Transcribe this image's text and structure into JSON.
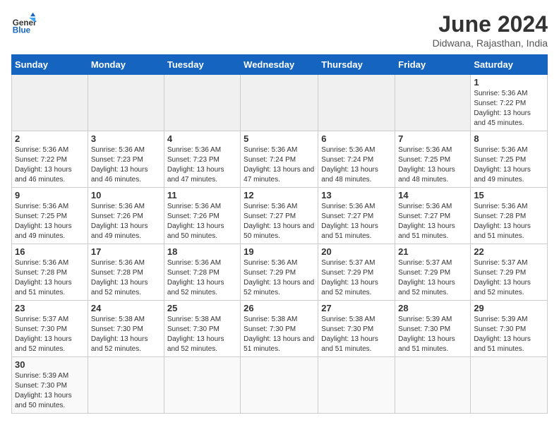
{
  "logo": {
    "text_general": "General",
    "text_blue": "Blue"
  },
  "header": {
    "month_year": "June 2024",
    "location": "Didwana, Rajasthan, India"
  },
  "weekdays": [
    "Sunday",
    "Monday",
    "Tuesday",
    "Wednesday",
    "Thursday",
    "Friday",
    "Saturday"
  ],
  "weeks": [
    [
      {
        "day": "",
        "empty": true
      },
      {
        "day": "",
        "empty": true
      },
      {
        "day": "",
        "empty": true
      },
      {
        "day": "",
        "empty": true
      },
      {
        "day": "",
        "empty": true
      },
      {
        "day": "",
        "empty": true
      },
      {
        "day": "1",
        "sunrise": "5:36 AM",
        "sunset": "7:22 PM",
        "daylight": "13 hours and 45 minutes."
      }
    ],
    [
      {
        "day": "2",
        "sunrise": "5:36 AM",
        "sunset": "7:22 PM",
        "daylight": "13 hours and 46 minutes."
      },
      {
        "day": "3",
        "sunrise": "5:36 AM",
        "sunset": "7:23 PM",
        "daylight": "13 hours and 46 minutes."
      },
      {
        "day": "4",
        "sunrise": "5:36 AM",
        "sunset": "7:23 PM",
        "daylight": "13 hours and 47 minutes."
      },
      {
        "day": "5",
        "sunrise": "5:36 AM",
        "sunset": "7:24 PM",
        "daylight": "13 hours and 47 minutes."
      },
      {
        "day": "6",
        "sunrise": "5:36 AM",
        "sunset": "7:24 PM",
        "daylight": "13 hours and 48 minutes."
      },
      {
        "day": "7",
        "sunrise": "5:36 AM",
        "sunset": "7:25 PM",
        "daylight": "13 hours and 48 minutes."
      },
      {
        "day": "8",
        "sunrise": "5:36 AM",
        "sunset": "7:25 PM",
        "daylight": "13 hours and 49 minutes."
      }
    ],
    [
      {
        "day": "9",
        "sunrise": "5:36 AM",
        "sunset": "7:25 PM",
        "daylight": "13 hours and 49 minutes."
      },
      {
        "day": "10",
        "sunrise": "5:36 AM",
        "sunset": "7:26 PM",
        "daylight": "13 hours and 49 minutes."
      },
      {
        "day": "11",
        "sunrise": "5:36 AM",
        "sunset": "7:26 PM",
        "daylight": "13 hours and 50 minutes."
      },
      {
        "day": "12",
        "sunrise": "5:36 AM",
        "sunset": "7:27 PM",
        "daylight": "13 hours and 50 minutes."
      },
      {
        "day": "13",
        "sunrise": "5:36 AM",
        "sunset": "7:27 PM",
        "daylight": "13 hours and 51 minutes."
      },
      {
        "day": "14",
        "sunrise": "5:36 AM",
        "sunset": "7:27 PM",
        "daylight": "13 hours and 51 minutes."
      },
      {
        "day": "15",
        "sunrise": "5:36 AM",
        "sunset": "7:28 PM",
        "daylight": "13 hours and 51 minutes."
      }
    ],
    [
      {
        "day": "16",
        "sunrise": "5:36 AM",
        "sunset": "7:28 PM",
        "daylight": "13 hours and 51 minutes."
      },
      {
        "day": "17",
        "sunrise": "5:36 AM",
        "sunset": "7:28 PM",
        "daylight": "13 hours and 52 minutes."
      },
      {
        "day": "18",
        "sunrise": "5:36 AM",
        "sunset": "7:28 PM",
        "daylight": "13 hours and 52 minutes."
      },
      {
        "day": "19",
        "sunrise": "5:36 AM",
        "sunset": "7:29 PM",
        "daylight": "13 hours and 52 minutes."
      },
      {
        "day": "20",
        "sunrise": "5:37 AM",
        "sunset": "7:29 PM",
        "daylight": "13 hours and 52 minutes."
      },
      {
        "day": "21",
        "sunrise": "5:37 AM",
        "sunset": "7:29 PM",
        "daylight": "13 hours and 52 minutes."
      },
      {
        "day": "22",
        "sunrise": "5:37 AM",
        "sunset": "7:29 PM",
        "daylight": "13 hours and 52 minutes."
      }
    ],
    [
      {
        "day": "23",
        "sunrise": "5:37 AM",
        "sunset": "7:30 PM",
        "daylight": "13 hours and 52 minutes."
      },
      {
        "day": "24",
        "sunrise": "5:38 AM",
        "sunset": "7:30 PM",
        "daylight": "13 hours and 52 minutes."
      },
      {
        "day": "25",
        "sunrise": "5:38 AM",
        "sunset": "7:30 PM",
        "daylight": "13 hours and 52 minutes."
      },
      {
        "day": "26",
        "sunrise": "5:38 AM",
        "sunset": "7:30 PM",
        "daylight": "13 hours and 51 minutes."
      },
      {
        "day": "27",
        "sunrise": "5:38 AM",
        "sunset": "7:30 PM",
        "daylight": "13 hours and 51 minutes."
      },
      {
        "day": "28",
        "sunrise": "5:39 AM",
        "sunset": "7:30 PM",
        "daylight": "13 hours and 51 minutes."
      },
      {
        "day": "29",
        "sunrise": "5:39 AM",
        "sunset": "7:30 PM",
        "daylight": "13 hours and 51 minutes."
      }
    ],
    [
      {
        "day": "30",
        "sunrise": "5:39 AM",
        "sunset": "7:30 PM",
        "daylight": "13 hours and 50 minutes."
      },
      {
        "day": "",
        "empty": true
      },
      {
        "day": "",
        "empty": true
      },
      {
        "day": "",
        "empty": true
      },
      {
        "day": "",
        "empty": true
      },
      {
        "day": "",
        "empty": true
      },
      {
        "day": "",
        "empty": true
      }
    ]
  ]
}
